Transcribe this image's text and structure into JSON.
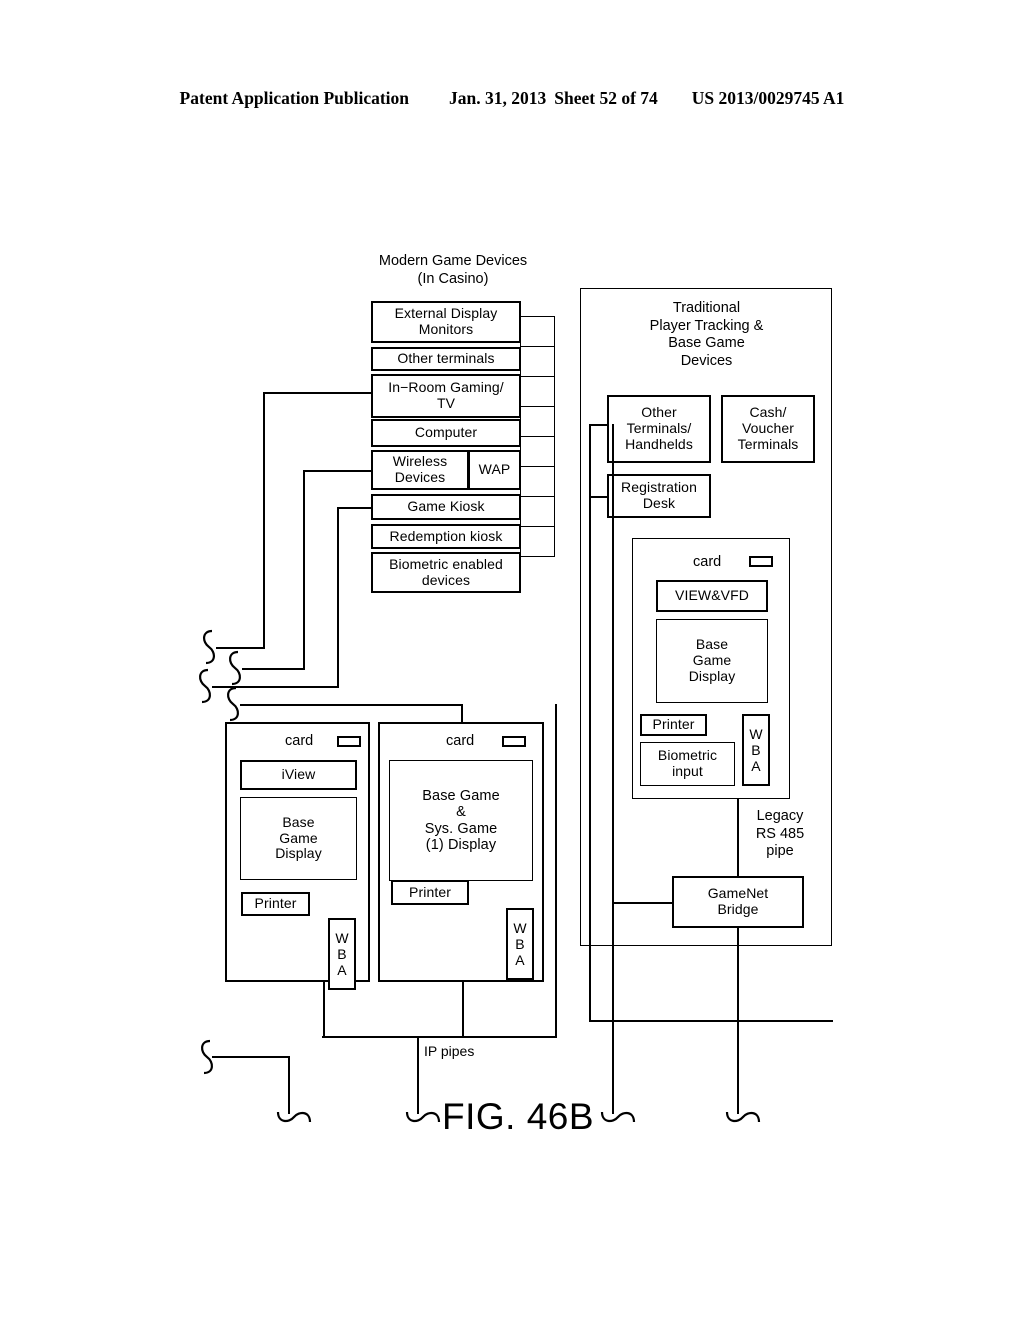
{
  "header": {
    "publication": "Patent Application Publication",
    "date": "Jan. 31, 2013",
    "sheet": "Sheet 52 of 74",
    "docket": "US 2013/0029745 A1"
  },
  "figure": {
    "title": "FIG. 46B",
    "left_group_title": "Modern Game Devices\n(In Casino)",
    "right_group_title": "Traditional\nPlayer Tracking &\nBase Game\nDevices",
    "modern_devices": [
      {
        "label": "External Display\nMonitors"
      },
      {
        "label": "Other  terminals"
      },
      {
        "label": "In−Room Gaming/\nTV"
      },
      {
        "label": "Computer"
      },
      {
        "label": "Wireless\nDevices",
        "sub_label": "WAP"
      },
      {
        "label": "Game  Kiosk"
      },
      {
        "label": "Redemption  kiosk"
      },
      {
        "label": "Biometric  enabled\ndevices"
      }
    ],
    "traditional_devices": [
      {
        "label": "Other\nTerminals/\nHandhelds"
      },
      {
        "label": "Cash/\nVoucher\nTerminals"
      },
      {
        "label": "Registration\nDesk"
      }
    ],
    "legacy_cabinet": {
      "card_label": "card",
      "view_vfd": "VIEW&VFD",
      "base_game_display": "Base\nGame\nDisplay",
      "printer": "Printer",
      "biometric_input": "Biometric\ninput",
      "wba": [
        "W",
        "B",
        "A"
      ]
    },
    "cabinet_left": {
      "card_label": "card",
      "iview": "iView",
      "base_game_display": "Base\nGame\nDisplay",
      "printer": "Printer",
      "wba": [
        "W",
        "B",
        "A"
      ]
    },
    "cabinet_right": {
      "card_label": "card",
      "display": "Base  Game\n&\nSys.  Game\n(1)  Display",
      "printer": "Printer",
      "wba": [
        "W",
        "B",
        "A"
      ]
    },
    "gamenet_bridge": "GameNet\nBridge",
    "legacy_pipe_label": "Legacy\nRS  485\npipe",
    "ip_pipes_label": "IP  pipes",
    "colors": {
      "ink": "#000000",
      "paper": "#ffffff"
    }
  }
}
